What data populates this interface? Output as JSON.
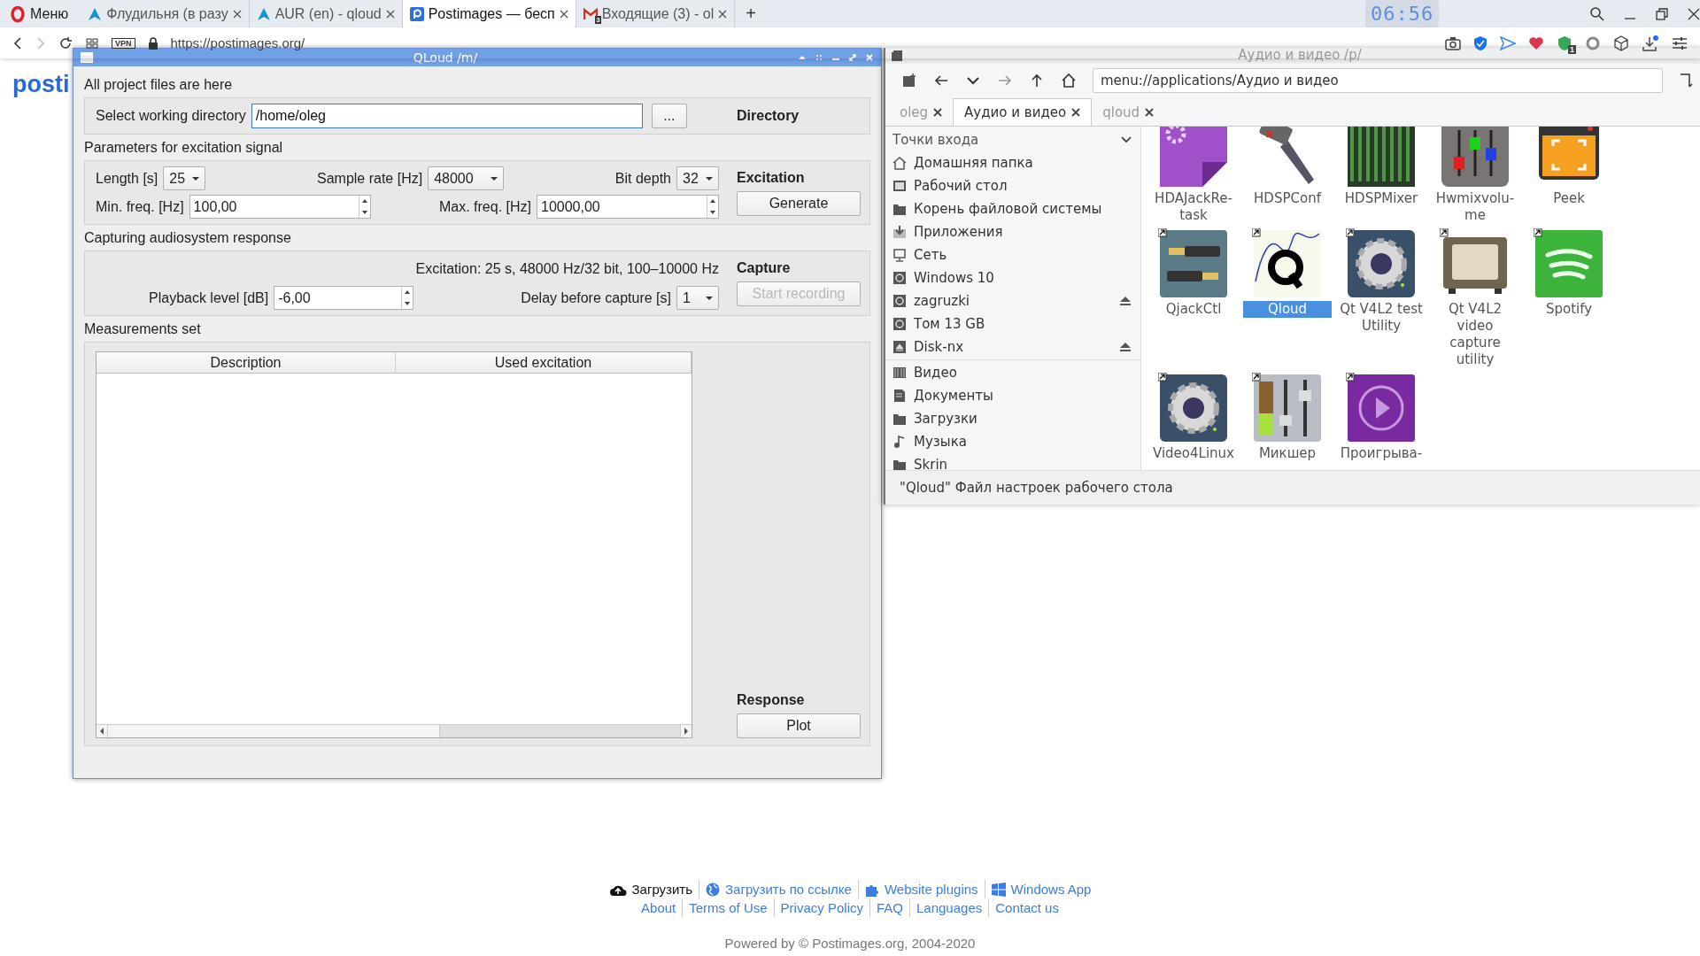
{
  "browser": {
    "menu": "Меню",
    "tabs": [
      {
        "title": "Флудильня (в разу",
        "kind": "arch",
        "selected": false
      },
      {
        "title": "AUR (en) - qloud",
        "kind": "arch",
        "selected": false
      },
      {
        "title": "Postimages — бесп",
        "kind": "postimages",
        "selected": true
      },
      {
        "title": "Входящие (3) - ol",
        "kind": "mail",
        "badge": "3",
        "selected": false
      }
    ],
    "new_tab": "+",
    "clock": "06:56",
    "vpn": "VPN",
    "url": "https://postimages.org/",
    "extension_badge": "1"
  },
  "page": {
    "logo": "posti",
    "footer_row_1": [
      {
        "label": "Загрузить",
        "kind": "upload"
      },
      {
        "label": "Загрузить по ссылке",
        "kind": "globe"
      },
      {
        "label": "Website plugins",
        "kind": "puzzle"
      },
      {
        "label": "Windows App",
        "kind": "windows"
      }
    ],
    "footer_row_2": [
      "About",
      "Terms of Use",
      "Privacy Policy",
      "FAQ",
      "Languages",
      "Contact us"
    ],
    "powered": "Powered by © Postimages.org, 2004-2020"
  },
  "qloud": {
    "title": "QLoud  /m/",
    "directory": {
      "caption": "All project files are here",
      "label": "Select working directory",
      "value": "/home/oleg",
      "browse": "...",
      "heading": "Directory"
    },
    "excitation": {
      "caption": "Parameters for excitation signal",
      "length_label": "Length [s]",
      "length": "25",
      "rate_label": "Sample rate [Hz]",
      "rate": "48000",
      "depth_label": "Bit depth",
      "depth": "32",
      "min_label": "Min. freq. [Hz]",
      "min": "100,00",
      "max_label": "Max. freq. [Hz]",
      "max": "10000,00",
      "heading": "Excitation",
      "button": {
        "label": "Generate",
        "disabled": false
      }
    },
    "capture": {
      "caption": "Capturing audiosystem response",
      "info": "Excitation: 25 s, 48000 Hz/32 bit, 100–10000 Hz",
      "level_label": "Playback level [dB]",
      "level_value": "-6,00",
      "delay_label": "Delay before capture [s]",
      "delay": "1",
      "heading": "Capture",
      "button": {
        "label": "Start recording",
        "disabled": true
      }
    },
    "measurements": {
      "caption": "Measurements set",
      "columns": [
        "Description",
        "Used excitation"
      ],
      "heading": "Response",
      "button": {
        "label": "Plot",
        "disabled": false
      }
    }
  },
  "file_manager": {
    "title": "Аудио и видео  /p/",
    "path": "menu://applications/Аудио и видео",
    "tabs": [
      {
        "label": "oleg",
        "selected": false
      },
      {
        "label": "Аудио и видео",
        "selected": true
      },
      {
        "label": "qloud",
        "selected": false
      }
    ],
    "places_heading": "Точки входа",
    "places": [
      {
        "label": "Домашняя папка",
        "kind": "home",
        "eject": false
      },
      {
        "label": "Рабочий стол",
        "kind": "desktop",
        "eject": false
      },
      {
        "label": "Корень файловой системы",
        "kind": "folder",
        "eject": false
      },
      {
        "label": "Приложения",
        "kind": "apps",
        "eject": false
      },
      {
        "label": "Сеть",
        "kind": "network",
        "eject": false
      },
      {
        "label": "Windows 10",
        "kind": "drive",
        "eject": false
      },
      {
        "label": "zagruzki",
        "kind": "drive",
        "eject": true
      },
      {
        "label": "Том 13 GB",
        "kind": "drive",
        "eject": false
      },
      {
        "label": "Disk-nx",
        "kind": "disk",
        "eject": true
      }
    ],
    "folders": [
      {
        "label": "Видео",
        "kind": "film"
      },
      {
        "label": "Документы",
        "kind": "doc"
      },
      {
        "label": "Загрузки",
        "kind": "folder"
      },
      {
        "label": "Музыка",
        "kind": "note"
      },
      {
        "label": "Skrin",
        "kind": "folder"
      }
    ],
    "apps": [
      {
        "label": "HDAJackRe-task",
        "kind": "gear-doc",
        "selected": false
      },
      {
        "label": "HDSPConf",
        "kind": "hammer",
        "selected": false
      },
      {
        "label": "HDSPMixer",
        "kind": "mixer",
        "selected": false
      },
      {
        "label": "Hwmixvolu-me",
        "kind": "faders",
        "selected": false
      },
      {
        "label": "Peek",
        "kind": "screen",
        "selected": false
      },
      {
        "label": "QjackCtl",
        "kind": "plugs",
        "selected": false
      },
      {
        "label": "Qloud",
        "kind": "graph",
        "selected": true
      },
      {
        "label": "Qt V4L2 test Utility",
        "kind": "camera",
        "selected": false
      },
      {
        "label": "Qt V4L2 video capture utility",
        "kind": "tv",
        "selected": false
      },
      {
        "label": "Spotify",
        "kind": "waves",
        "selected": false
      },
      {
        "label": "Video4Linux",
        "kind": "camera",
        "selected": false
      },
      {
        "label": "Микшер",
        "kind": "levels",
        "selected": false
      },
      {
        "label": "Проигрыва-",
        "kind": "play",
        "selected": false
      }
    ],
    "status": "\"Qloud\" Файл настроек рабочего стола"
  }
}
